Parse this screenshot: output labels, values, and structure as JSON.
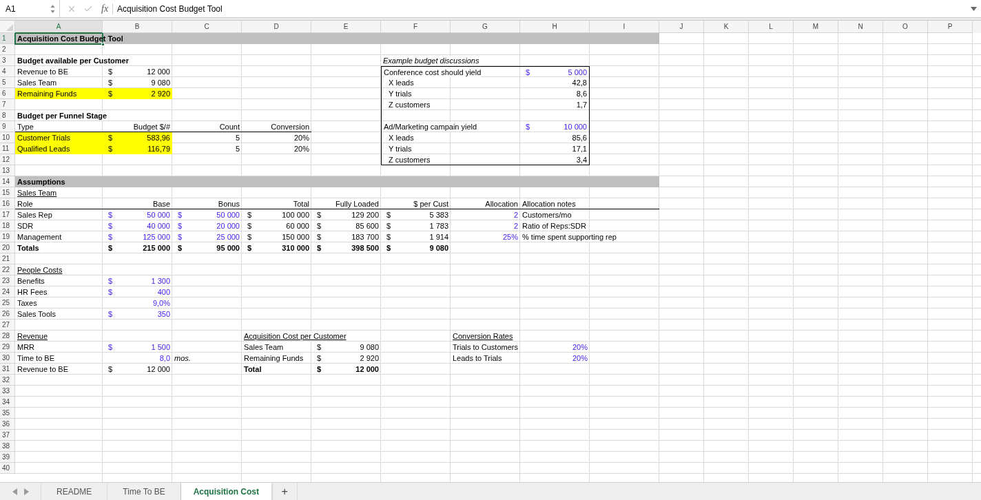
{
  "formula_bar": {
    "name_box": "A1",
    "function_label": "fx",
    "formula": "Acquisition Cost Budget Tool"
  },
  "columns": [
    {
      "label": "A",
      "selected": true
    },
    {
      "label": "B",
      "selected": false
    },
    {
      "label": "C",
      "selected": false
    },
    {
      "label": "D",
      "selected": false
    },
    {
      "label": "E",
      "selected": false
    },
    {
      "label": "F",
      "selected": false
    },
    {
      "label": "G",
      "selected": false
    },
    {
      "label": "H",
      "selected": false
    },
    {
      "label": "I",
      "selected": false
    },
    {
      "label": "J",
      "selected": false
    },
    {
      "label": "K",
      "selected": false
    },
    {
      "label": "L",
      "selected": false
    },
    {
      "label": "M",
      "selected": false
    },
    {
      "label": "N",
      "selected": false
    },
    {
      "label": "O",
      "selected": false
    },
    {
      "label": "P",
      "selected": false
    }
  ],
  "rows": [
    {
      "number": "1",
      "selected": true,
      "band": true,
      "cells": {
        "A": {
          "kind": "text",
          "text": "Acquisition Cost Budget Tool",
          "bold": true
        }
      }
    },
    {
      "number": "2",
      "selected": false
    },
    {
      "number": "3",
      "selected": false,
      "cells": {
        "A": {
          "kind": "text",
          "text": "Budget available per Customer",
          "bold": true
        },
        "F": {
          "kind": "text",
          "text": "Example budget discussions",
          "italic": true
        }
      }
    },
    {
      "number": "4",
      "selected": false,
      "cells": {
        "A": {
          "kind": "text",
          "text": "Revenue to BE"
        },
        "B": {
          "kind": "money",
          "currency": "$",
          "text": "12 000"
        },
        "F": {
          "kind": "text",
          "text": "Conference cost should yield",
          "top_border": true,
          "left_border": true
        },
        "G": {
          "top_border": true
        },
        "H": {
          "kind": "money",
          "currency": "$",
          "text": "5 000",
          "input": true,
          "top_border": true,
          "right_border": true
        }
      }
    },
    {
      "number": "5",
      "selected": false,
      "cells": {
        "A": {
          "kind": "text",
          "text": "Sales Team"
        },
        "B": {
          "kind": "money",
          "currency": "$",
          "text": "9 080"
        },
        "F": {
          "kind": "text",
          "text": "X leads",
          "indent": true,
          "left_border": true
        },
        "H": {
          "kind": "number",
          "text": "42,8",
          "right_border": true
        }
      }
    },
    {
      "number": "6",
      "selected": false,
      "cells": {
        "A": {
          "kind": "text",
          "text": "Remaining Funds",
          "highlighted": true
        },
        "B": {
          "kind": "money",
          "currency": "$",
          "text": "2 920",
          "highlighted": true
        },
        "F": {
          "kind": "text",
          "text": "Y trials",
          "indent": true,
          "left_border": true
        },
        "H": {
          "kind": "number",
          "text": "8,6",
          "right_border": true
        }
      }
    },
    {
      "number": "7",
      "selected": false,
      "cells": {
        "F": {
          "kind": "text",
          "text": "Z customers",
          "indent": true,
          "left_border": true
        },
        "H": {
          "kind": "number",
          "text": "1,7",
          "right_border": true
        }
      }
    },
    {
      "number": "8",
      "selected": false,
      "cells": {
        "A": {
          "kind": "text",
          "text": "Budget per Funnel Stage",
          "bold": true
        },
        "F": {
          "left_border": true
        },
        "H": {
          "right_border": true
        }
      }
    },
    {
      "number": "9",
      "selected": false,
      "cells": {
        "A": {
          "kind": "text",
          "text": "Type",
          "bottom_border": true
        },
        "B": {
          "kind": "number",
          "text": "Budget $/#",
          "bottom_border": true
        },
        "C": {
          "kind": "number",
          "text": "Count",
          "bottom_border": true
        },
        "D": {
          "kind": "number",
          "text": "Conversion",
          "bottom_border": true
        },
        "F": {
          "kind": "text",
          "text": "Ad/Marketing campain yield",
          "left_border": true
        },
        "H": {
          "kind": "money",
          "currency": "$",
          "text": "10 000",
          "input": true,
          "right_border": true
        }
      }
    },
    {
      "number": "10",
      "selected": false,
      "cells": {
        "A": {
          "kind": "text",
          "text": "Customer Trials",
          "highlighted": true
        },
        "B": {
          "kind": "money",
          "currency": "$",
          "text": "583,96",
          "highlighted": true
        },
        "C": {
          "kind": "number",
          "text": "5"
        },
        "D": {
          "kind": "number",
          "text": "20%"
        },
        "F": {
          "kind": "text",
          "text": "X leads",
          "indent": true,
          "left_border": true
        },
        "H": {
          "kind": "number",
          "text": "85,6",
          "right_border": true
        }
      }
    },
    {
      "number": "11",
      "selected": false,
      "cells": {
        "A": {
          "kind": "text",
          "text": "Qualified Leads",
          "highlighted": true
        },
        "B": {
          "kind": "money",
          "currency": "$",
          "text": "116,79",
          "highlighted": true
        },
        "C": {
          "kind": "number",
          "text": "5"
        },
        "D": {
          "kind": "number",
          "text": "20%"
        },
        "F": {
          "kind": "text",
          "text": "Y trials",
          "indent": true,
          "left_border": true
        },
        "H": {
          "kind": "number",
          "text": "17,1",
          "right_border": true
        }
      }
    },
    {
      "number": "12",
      "selected": false,
      "cells": {
        "F": {
          "kind": "text",
          "text": "Z customers",
          "indent": true,
          "left_border": true,
          "bottom_border": true
        },
        "G": {
          "bottom_border": true
        },
        "H": {
          "kind": "number",
          "text": "3,4",
          "right_border": true,
          "bottom_border": true
        }
      }
    },
    {
      "number": "13",
      "selected": false
    },
    {
      "number": "14",
      "selected": false,
      "band": true,
      "cells": {
        "A": {
          "kind": "text",
          "text": "Assumptions",
          "bold": true
        }
      }
    },
    {
      "number": "15",
      "selected": false,
      "cells": {
        "A": {
          "kind": "text",
          "text": "Sales Team",
          "underlined": true
        }
      }
    },
    {
      "number": "16",
      "selected": false,
      "cells": {
        "A": {
          "kind": "text",
          "text": "Role",
          "bottom_border": true
        },
        "B": {
          "kind": "number",
          "text": "Base",
          "bottom_border": true
        },
        "C": {
          "kind": "number",
          "text": "Bonus",
          "bottom_border": true
        },
        "D": {
          "kind": "number",
          "text": "Total",
          "bottom_border": true
        },
        "E": {
          "kind": "number",
          "text": "Fully Loaded",
          "bottom_border": true
        },
        "F": {
          "kind": "number",
          "text": "$ per Cust",
          "bottom_border": true
        },
        "G": {
          "kind": "number",
          "text": "Allocation",
          "bottom_border": true
        },
        "H": {
          "kind": "text",
          "text": "Allocation notes",
          "bottom_border": true
        },
        "I": {
          "bottom_border": true
        }
      }
    },
    {
      "number": "17",
      "selected": false,
      "cells": {
        "A": {
          "kind": "text",
          "text": "Sales Rep"
        },
        "B": {
          "kind": "money",
          "currency": "$",
          "text": "50 000",
          "input": true
        },
        "C": {
          "kind": "money",
          "currency": "$",
          "text": "50 000",
          "input": true
        },
        "D": {
          "kind": "money",
          "currency": "$",
          "text": "100 000"
        },
        "E": {
          "kind": "money",
          "currency": "$",
          "text": "129 200"
        },
        "F": {
          "kind": "money",
          "currency": "$",
          "text": "5 383"
        },
        "G": {
          "kind": "number",
          "text": "2",
          "input": true
        },
        "H": {
          "kind": "text",
          "text": "Customers/mo"
        }
      }
    },
    {
      "number": "18",
      "selected": false,
      "cells": {
        "A": {
          "kind": "text",
          "text": "SDR"
        },
        "B": {
          "kind": "money",
          "currency": "$",
          "text": "40 000",
          "input": true
        },
        "C": {
          "kind": "money",
          "currency": "$",
          "text": "20 000",
          "input": true
        },
        "D": {
          "kind": "money",
          "currency": "$",
          "text": "60 000"
        },
        "E": {
          "kind": "money",
          "currency": "$",
          "text": "85 600"
        },
        "F": {
          "kind": "money",
          "currency": "$",
          "text": "1 783"
        },
        "G": {
          "kind": "number",
          "text": "2",
          "input": true
        },
        "H": {
          "kind": "text",
          "text": "Ratio of Reps:SDR"
        }
      }
    },
    {
      "number": "19",
      "selected": false,
      "cells": {
        "A": {
          "kind": "text",
          "text": "Management"
        },
        "B": {
          "kind": "money",
          "currency": "$",
          "text": "125 000",
          "input": true
        },
        "C": {
          "kind": "money",
          "currency": "$",
          "text": "25 000",
          "input": true
        },
        "D": {
          "kind": "money",
          "currency": "$",
          "text": "150 000"
        },
        "E": {
          "kind": "money",
          "currency": "$",
          "text": "183 700"
        },
        "F": {
          "kind": "money",
          "currency": "$",
          "text": "1 914"
        },
        "G": {
          "kind": "number",
          "text": "25%",
          "input": true
        },
        "H": {
          "kind": "text",
          "text": "% time spent supporting rep"
        }
      }
    },
    {
      "number": "20",
      "selected": false,
      "cells": {
        "A": {
          "kind": "text",
          "text": "Totals",
          "bold": true
        },
        "B": {
          "kind": "money",
          "currency": "$",
          "text": "215 000",
          "bold": true
        },
        "C": {
          "kind": "money",
          "currency": "$",
          "text": "95 000",
          "bold": true
        },
        "D": {
          "kind": "money",
          "currency": "$",
          "text": "310 000",
          "bold": true
        },
        "E": {
          "kind": "money",
          "currency": "$",
          "text": "398 500",
          "bold": true
        },
        "F": {
          "kind": "money",
          "currency": "$",
          "text": "9 080",
          "bold": true
        }
      }
    },
    {
      "number": "21",
      "selected": false
    },
    {
      "number": "22",
      "selected": false,
      "cells": {
        "A": {
          "kind": "text",
          "text": "People Costs",
          "underlined": true
        }
      }
    },
    {
      "number": "23",
      "selected": false,
      "cells": {
        "A": {
          "kind": "text",
          "text": "Benefits"
        },
        "B": {
          "kind": "money",
          "currency": "$",
          "text": "1 300",
          "input": true
        }
      }
    },
    {
      "number": "24",
      "selected": false,
      "cells": {
        "A": {
          "kind": "text",
          "text": "HR Fees"
        },
        "B": {
          "kind": "money",
          "currency": "$",
          "text": "400",
          "input": true
        }
      }
    },
    {
      "number": "25",
      "selected": false,
      "cells": {
        "A": {
          "kind": "text",
          "text": "Taxes"
        },
        "B": {
          "kind": "number",
          "text": "9,0%",
          "input": true
        }
      }
    },
    {
      "number": "26",
      "selected": false,
      "cells": {
        "A": {
          "kind": "text",
          "text": "Sales Tools"
        },
        "B": {
          "kind": "money",
          "currency": "$",
          "text": "350",
          "input": true
        }
      }
    },
    {
      "number": "27",
      "selected": false
    },
    {
      "number": "28",
      "selected": false,
      "cells": {
        "A": {
          "kind": "text",
          "text": "Revenue",
          "underlined": true
        },
        "D": {
          "kind": "text",
          "text": "Acquisition Cost per Customer",
          "underlined": true
        },
        "G": {
          "kind": "text",
          "text": "Conversion Rates",
          "underlined": true
        }
      }
    },
    {
      "number": "29",
      "selected": false,
      "cells": {
        "A": {
          "kind": "text",
          "text": "MRR"
        },
        "B": {
          "kind": "money",
          "currency": "$",
          "text": "1 500",
          "input": true
        },
        "D": {
          "kind": "text",
          "text": "Sales Team"
        },
        "E": {
          "kind": "money",
          "currency": "$",
          "text": "9 080"
        },
        "G": {
          "kind": "text",
          "text": "Trials to Customers"
        },
        "H": {
          "kind": "number",
          "text": "20%",
          "input": true
        }
      }
    },
    {
      "number": "30",
      "selected": false,
      "cells": {
        "A": {
          "kind": "text",
          "text": "Time to BE"
        },
        "B": {
          "kind": "number",
          "text": "8,0",
          "input": true
        },
        "C": {
          "kind": "text",
          "text": "mos.",
          "italic": true
        },
        "D": {
          "kind": "text",
          "text": "Remaining Funds"
        },
        "E": {
          "kind": "money",
          "currency": "$",
          "text": "2 920"
        },
        "G": {
          "kind": "text",
          "text": "Leads to Trials"
        },
        "H": {
          "kind": "number",
          "text": "20%",
          "input": true
        }
      }
    },
    {
      "number": "31",
      "selected": false,
      "cells": {
        "A": {
          "kind": "text",
          "text": "Revenue to BE"
        },
        "B": {
          "kind": "money",
          "currency": "$",
          "text": "12 000"
        },
        "D": {
          "kind": "text",
          "text": "Total",
          "bold": true
        },
        "E": {
          "kind": "money",
          "currency": "$",
          "text": "12 000",
          "bold": true
        }
      }
    },
    {
      "number": "32",
      "selected": false
    },
    {
      "number": "33",
      "selected": false
    },
    {
      "number": "34",
      "selected": false
    },
    {
      "number": "35",
      "selected": false
    },
    {
      "number": "36",
      "selected": false
    },
    {
      "number": "37",
      "selected": false
    },
    {
      "number": "38",
      "selected": false
    },
    {
      "number": "39",
      "selected": false
    },
    {
      "number": "40",
      "selected": false
    }
  ],
  "sheet_tabs": [
    {
      "label": "README",
      "selected": false
    },
    {
      "label": "Time To BE",
      "selected": false
    },
    {
      "label": "Acquisition Cost",
      "selected": true
    }
  ],
  "add_sheet": "+"
}
